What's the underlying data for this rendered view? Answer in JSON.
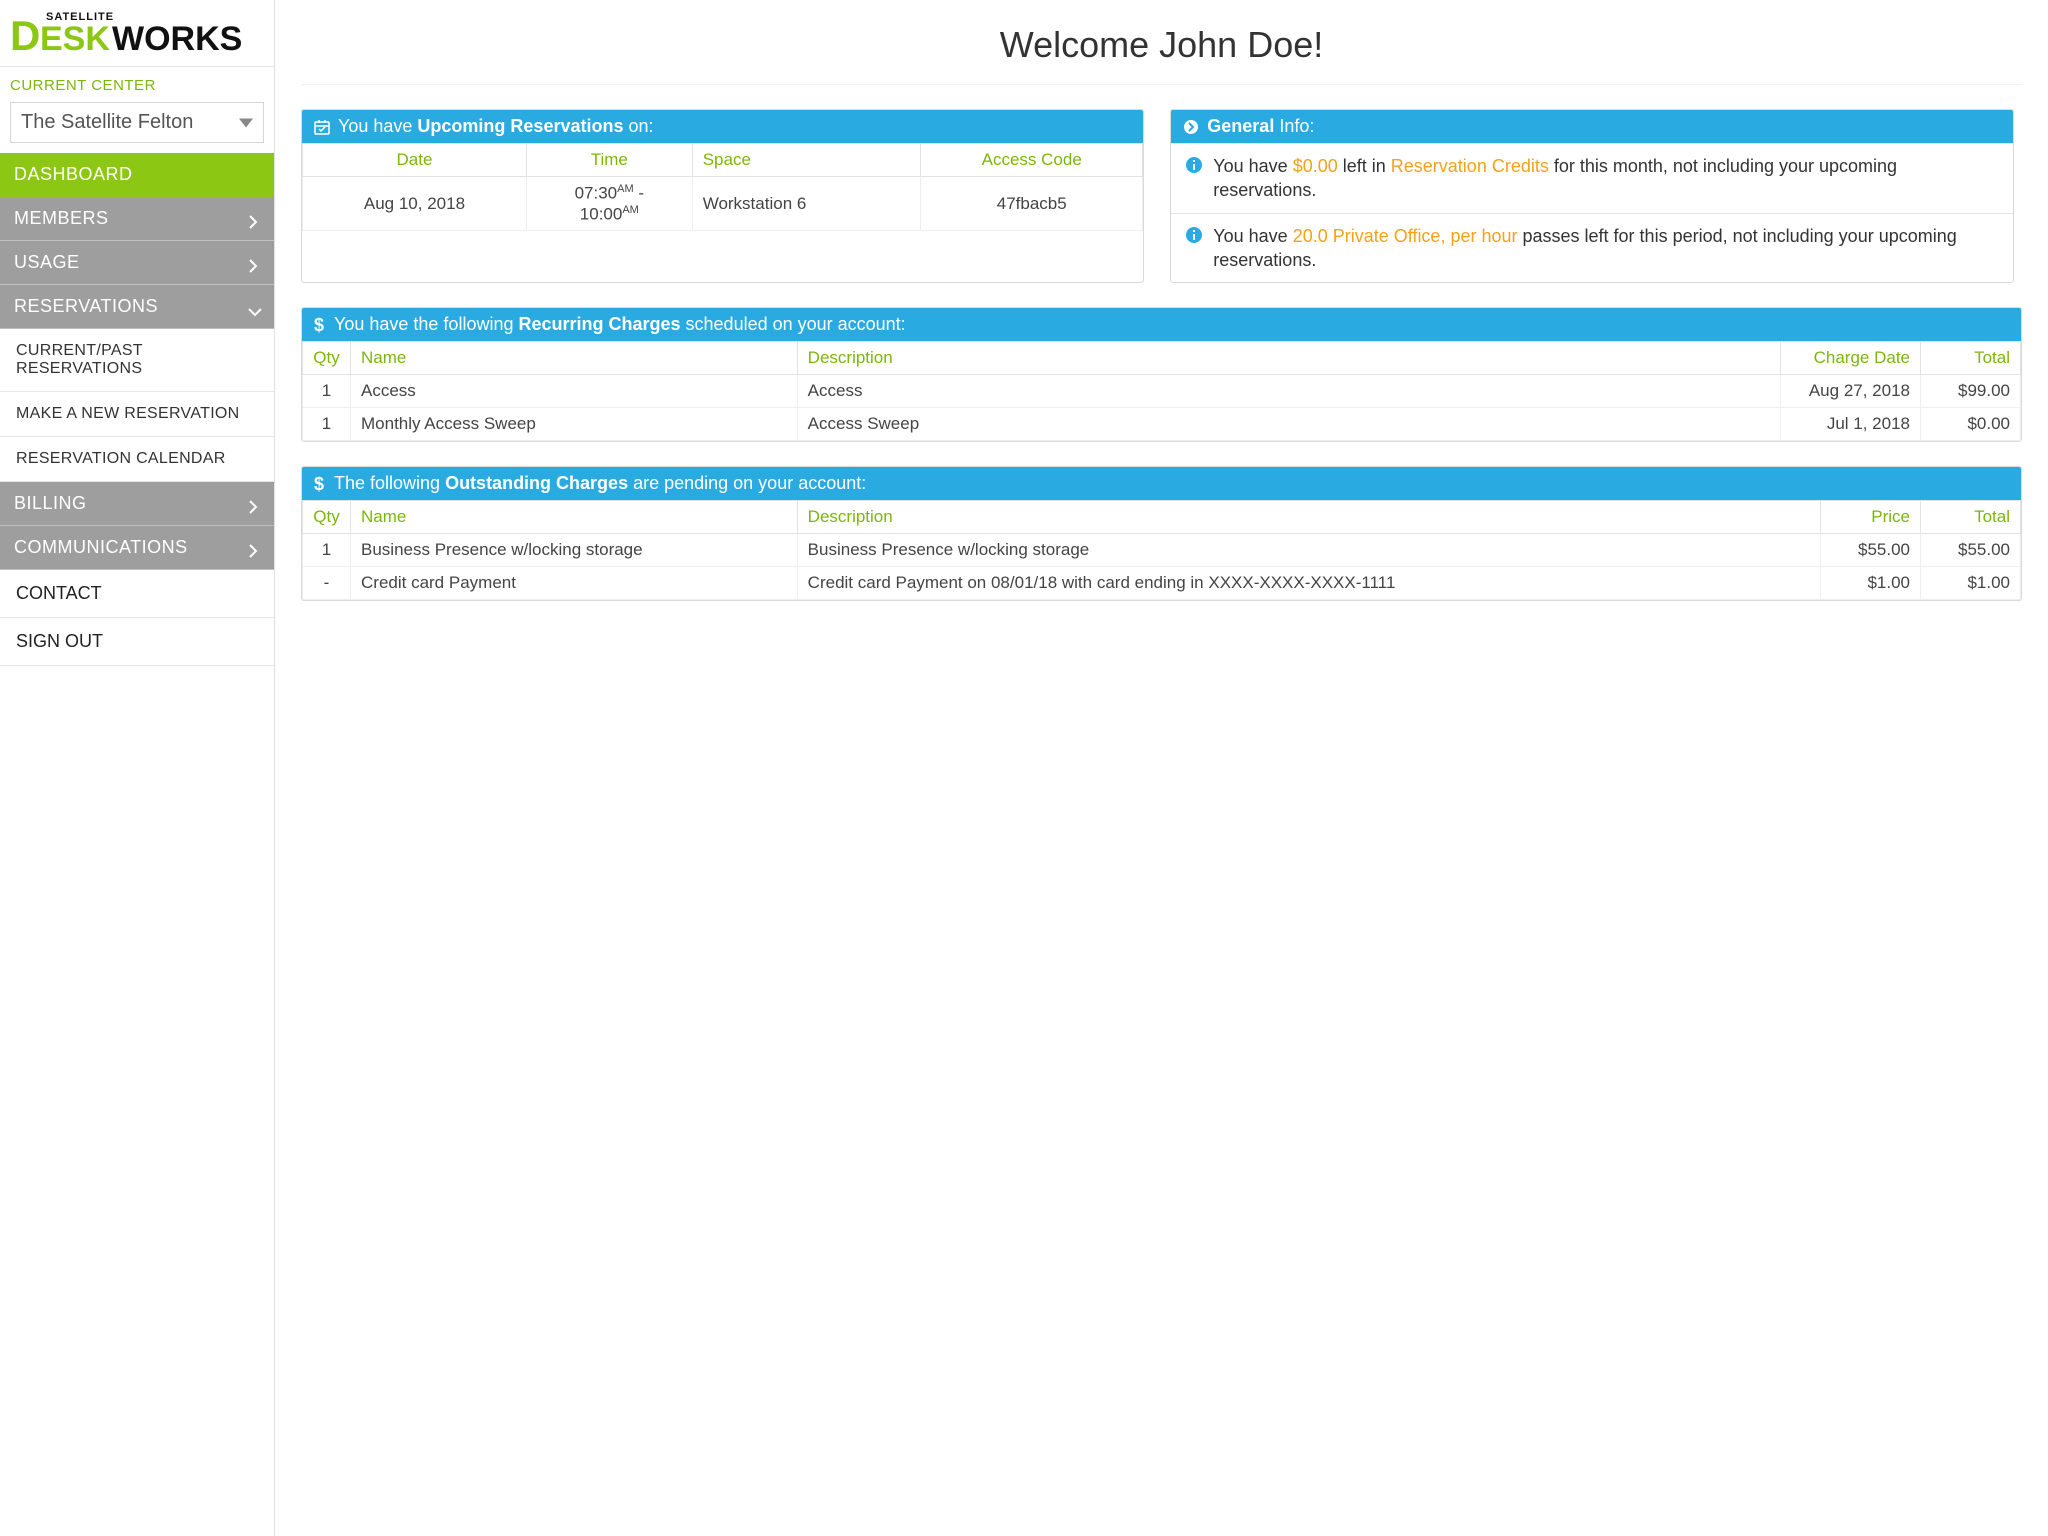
{
  "logo": {
    "brand_top": "SATELLITE",
    "brand_main_1": "D",
    "brand_main_2": "ESK",
    "brand_main_3": "WORKS"
  },
  "sidebar": {
    "current_center_label": "CURRENT CENTER",
    "current_center_value": "The Satellite Felton",
    "items": [
      {
        "label": "DASHBOARD",
        "kind": "active"
      },
      {
        "label": "MEMBERS",
        "kind": "main",
        "chev": "right"
      },
      {
        "label": "USAGE",
        "kind": "main",
        "chev": "right"
      },
      {
        "label": "RESERVATIONS",
        "kind": "main",
        "chev": "down"
      },
      {
        "label": "CURRENT/PAST RESERVATIONS",
        "kind": "sub"
      },
      {
        "label": "MAKE A NEW RESERVATION",
        "kind": "sub"
      },
      {
        "label": "RESERVATION CALENDAR",
        "kind": "sub"
      },
      {
        "label": "BILLING",
        "kind": "main",
        "chev": "right"
      },
      {
        "label": "COMMUNICATIONS",
        "kind": "main",
        "chev": "right"
      },
      {
        "label": "CONTACT",
        "kind": "plain"
      },
      {
        "label": "SIGN OUT",
        "kind": "plain"
      }
    ]
  },
  "header": {
    "welcome": "Welcome John Doe!"
  },
  "reservations": {
    "header_pre": "You have ",
    "header_bold": "Upcoming Reservations",
    "header_post": " on:",
    "columns": [
      "Date",
      "Time",
      "Space",
      "Access Code"
    ],
    "rows": [
      {
        "date": "Aug 10, 2018",
        "time_start": "07:30",
        "time_start_ampm": "AM",
        "time_sep": " - ",
        "time_end": "10:00",
        "time_end_ampm": "AM",
        "space": "Workstation 6",
        "code": "47fbacb5"
      }
    ]
  },
  "general": {
    "header_bold": "General",
    "header_post": " Info:",
    "info1_pre": "You have ",
    "info1_credits": "$0.00",
    "info1_mid": " left in ",
    "info1_link": "Reservation Credits",
    "info1_post": " for this month, not including your upcoming reservations.",
    "info2_pre": "You have ",
    "info2_hl": "20.0 Private Office, per hour",
    "info2_post": " passes left for this period, not including your upcoming reservations."
  },
  "recurring": {
    "header_pre": "You have the following ",
    "header_bold": "Recurring Charges",
    "header_post": " scheduled on your account:",
    "columns": [
      "Qty",
      "Name",
      "Description",
      "Charge Date",
      "Total"
    ],
    "rows": [
      {
        "qty": "1",
        "name": "Access",
        "desc": "Access",
        "date": "Aug 27, 2018",
        "total": "$99.00"
      },
      {
        "qty": "1",
        "name": "Monthly Access Sweep",
        "desc": "Access Sweep",
        "date": "Jul 1, 2018",
        "total": "$0.00"
      }
    ]
  },
  "outstanding": {
    "header_pre": "The following ",
    "header_bold": "Outstanding Charges",
    "header_post": " are pending on your account:",
    "columns": [
      "Qty",
      "Name",
      "Description",
      "Price",
      "Total"
    ],
    "rows": [
      {
        "qty": "1",
        "name": "Business Presence w/locking storage",
        "desc": "Business Presence w/locking storage",
        "price": "$55.00",
        "total": "$55.00"
      },
      {
        "qty": "-",
        "name": "Credit card Payment",
        "desc": "Credit card Payment on 08/01/18 with card ending in XXXX-XXXX-XXXX-1111",
        "price": "$1.00",
        "total": "$1.00"
      }
    ]
  }
}
